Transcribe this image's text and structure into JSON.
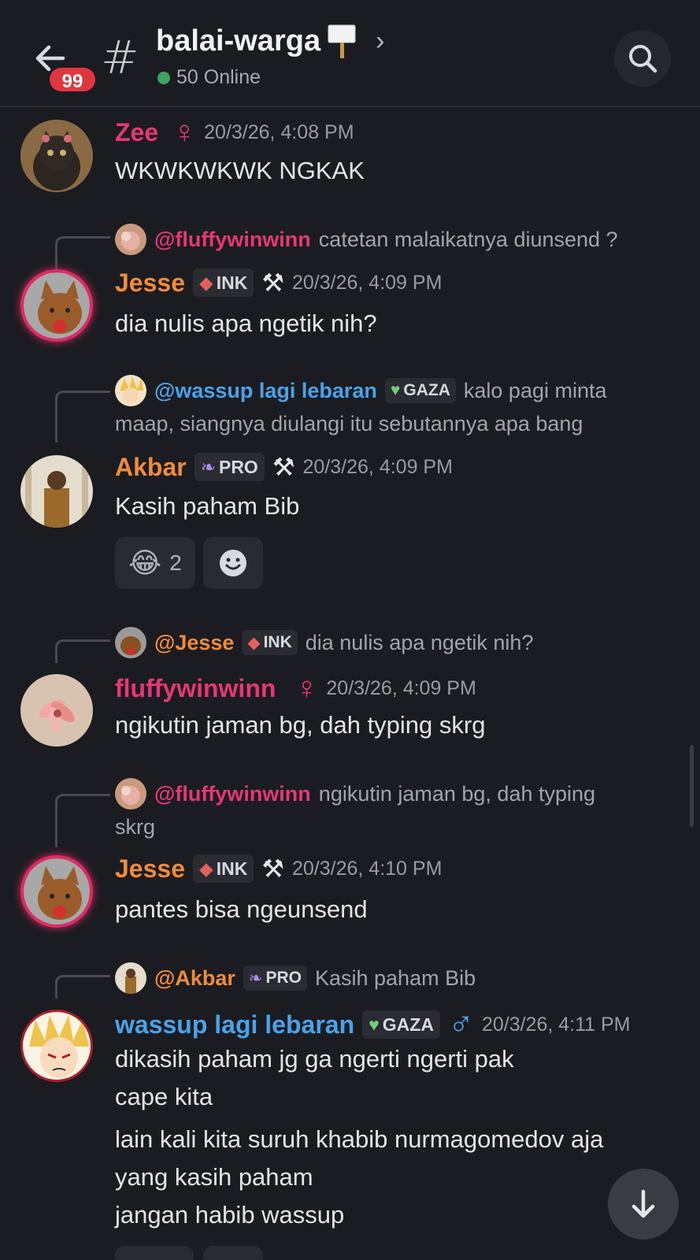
{
  "header": {
    "back_label": "Back",
    "unread_badge": "99",
    "channel_name": "balai-warga",
    "online_text": "50 Online"
  },
  "messages": [
    {
      "user": "Zee",
      "gender_symbol": "♀",
      "time": "20/3/26, 4:08 PM",
      "lines": [
        "WKWKWKWK NGKAK"
      ]
    },
    {
      "reply": {
        "name": "@fluffywinwinn",
        "text": "catetan malaikatnya diunsend ?"
      },
      "user": "Jesse",
      "tag": "INK",
      "time": "20/3/26, 4:09 PM",
      "lines": [
        "dia nulis apa ngetik nih?"
      ]
    },
    {
      "reply": {
        "name": "@wassup lagi lebaran",
        "tag": "GAZA",
        "text": "kalo pagi minta",
        "text2": "maap, siangnya diulangi itu sebutannya apa bang"
      },
      "user": "Akbar",
      "tag": "PRO",
      "time": "20/3/26, 4:09 PM",
      "lines": [
        "Kasih paham Bib"
      ],
      "reactions": [
        {
          "emoji": "😂",
          "count": "2"
        }
      ]
    },
    {
      "reply": {
        "name": "@Jesse",
        "tag": "INK",
        "text": "dia nulis apa ngetik nih?"
      },
      "user": "fluffywinwinn",
      "gender_symbol": "♀",
      "time": "20/3/26, 4:09 PM",
      "lines": [
        "ngikutin jaman bg, dah typing skrg"
      ]
    },
    {
      "reply": {
        "name": "@fluffywinwinn",
        "text": "ngikutin jaman bg, dah typing",
        "text2": "skrg"
      },
      "user": "Jesse",
      "tag": "INK",
      "time": "20/3/26, 4:10 PM",
      "lines": [
        "pantes bisa ngeunsend"
      ]
    },
    {
      "reply": {
        "name": "@Akbar",
        "tag": "PRO",
        "text": "Kasih paham Bib"
      },
      "user": "wassup lagi lebaran",
      "tag": "GAZA",
      "gender_symbol": "♂",
      "time": "20/3/26, 4:11 PM",
      "lines": [
        "dikasih paham jg ga ngerti ngerti pak",
        "cape kita",
        "lain kali kita suruh khabib nurmagomedov aja",
        "yang kasih paham",
        "jangan habib wassup"
      ]
    }
  ],
  "colors": {
    "background": "#1b1c21",
    "pink_name": "#e8367a",
    "orange_name": "#f08b3b",
    "blue_name": "#4aa3e8",
    "online_green": "#3fa45f",
    "badge_red": "#e0363d"
  }
}
